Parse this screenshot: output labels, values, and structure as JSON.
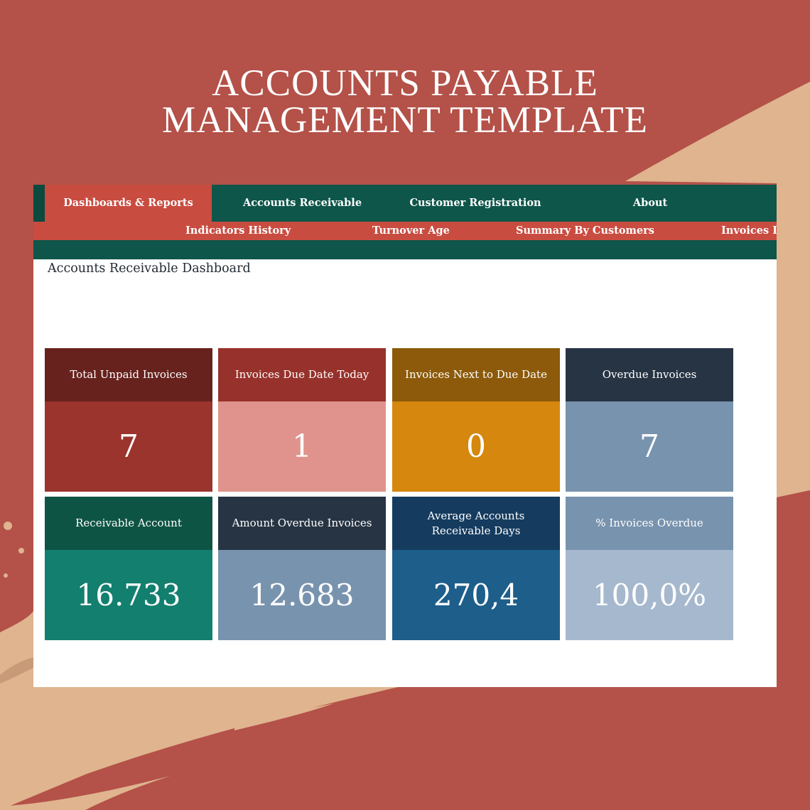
{
  "promo": {
    "title_line_1": "ACCOUNTS PAYABLE",
    "title_line_2": "MANAGEMENT TEMPLATE"
  },
  "colors": {
    "background": "#b45148",
    "swoosh": "#dfb48f",
    "nav_green": "#0e564a",
    "nav_active": "#c94c40",
    "title_text": "#222a33"
  },
  "main_nav": {
    "tabs": [
      {
        "label": "Dashboards & Reports",
        "active": true
      },
      {
        "label": "Accounts Receivable",
        "active": false
      },
      {
        "label": "Customer Registration",
        "active": false
      },
      {
        "label": "About",
        "active": false
      }
    ]
  },
  "sub_nav": {
    "items": [
      {
        "label": "Indicators History"
      },
      {
        "label": "Turnover Age"
      },
      {
        "label": "Summary By Customers"
      },
      {
        "label": "Invoices I"
      }
    ]
  },
  "page": {
    "title": "Accounts Receivable Dashboard"
  },
  "kpis": [
    {
      "label": "Total Unpaid Invoices",
      "value": "7",
      "head_color": "#67221e",
      "body_color": "#9a342c"
    },
    {
      "label": "Invoices Due Date Today",
      "value": "1",
      "head_color": "#97312b",
      "body_color": "#e0938c"
    },
    {
      "label": "Invoices Next to Due Date",
      "value": "0",
      "head_color": "#8c5a0a",
      "body_color": "#d5870e"
    },
    {
      "label": "Overdue Invoices",
      "value": "7",
      "head_color": "#273444",
      "body_color": "#7893ae"
    },
    {
      "label": "Receivable Account",
      "value": "16.733",
      "head_color": "#0e5445",
      "body_color": "#137f6e"
    },
    {
      "label": "Amount Overdue Invoices",
      "value": "12.683",
      "head_color": "#273444",
      "body_color": "#7893ae"
    },
    {
      "label": "Average Accounts Receivable Days",
      "value": "270,4",
      "head_color": "#153c5f",
      "body_color": "#1d5e8b"
    },
    {
      "label": "% Invoices Overdue",
      "value": "100,0%",
      "head_color": "#7893ae",
      "body_color": "#a6b8cd"
    }
  ]
}
